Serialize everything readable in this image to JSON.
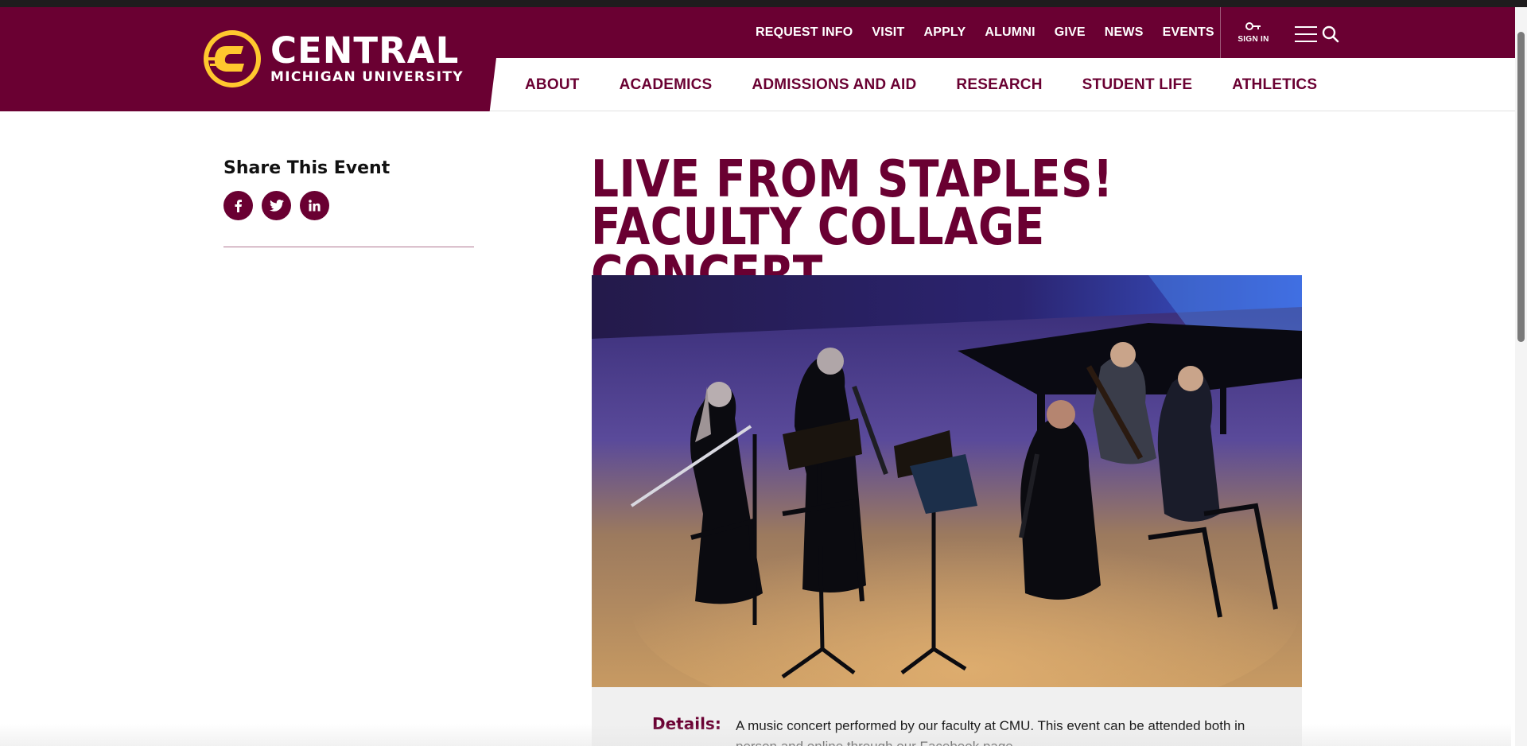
{
  "brand": {
    "name_line1": "CENTRAL",
    "name_line2": "MICHIGAN UNIVERSITY",
    "maroon": "#6a0032",
    "gold": "#ffc82e"
  },
  "utility_nav": {
    "items": [
      "REQUEST INFO",
      "VISIT",
      "APPLY",
      "ALUMNI",
      "GIVE",
      "NEWS",
      "EVENTS"
    ],
    "sign_in_label": "SIGN IN",
    "sign_in_icon": "key-icon",
    "menu_icon": "hamburger-menu-icon",
    "search_icon": "search-icon"
  },
  "main_nav": {
    "items": [
      "ABOUT",
      "ACADEMICS",
      "ADMISSIONS AND AID",
      "RESEARCH",
      "STUDENT LIFE",
      "ATHLETICS"
    ]
  },
  "share": {
    "title": "Share This Event",
    "icons": [
      "facebook-icon",
      "twitter-icon",
      "linkedin-icon"
    ]
  },
  "event": {
    "title": "LIVE FROM STAPLES! FACULTY COLLAGE CONCERT",
    "photo_alt": "Faculty woodwind quintet performing on stage",
    "details_label": "Details:",
    "details_text": "A music concert performed by our faculty at CMU. This event can be attended both in person and online through our Facebook page."
  }
}
